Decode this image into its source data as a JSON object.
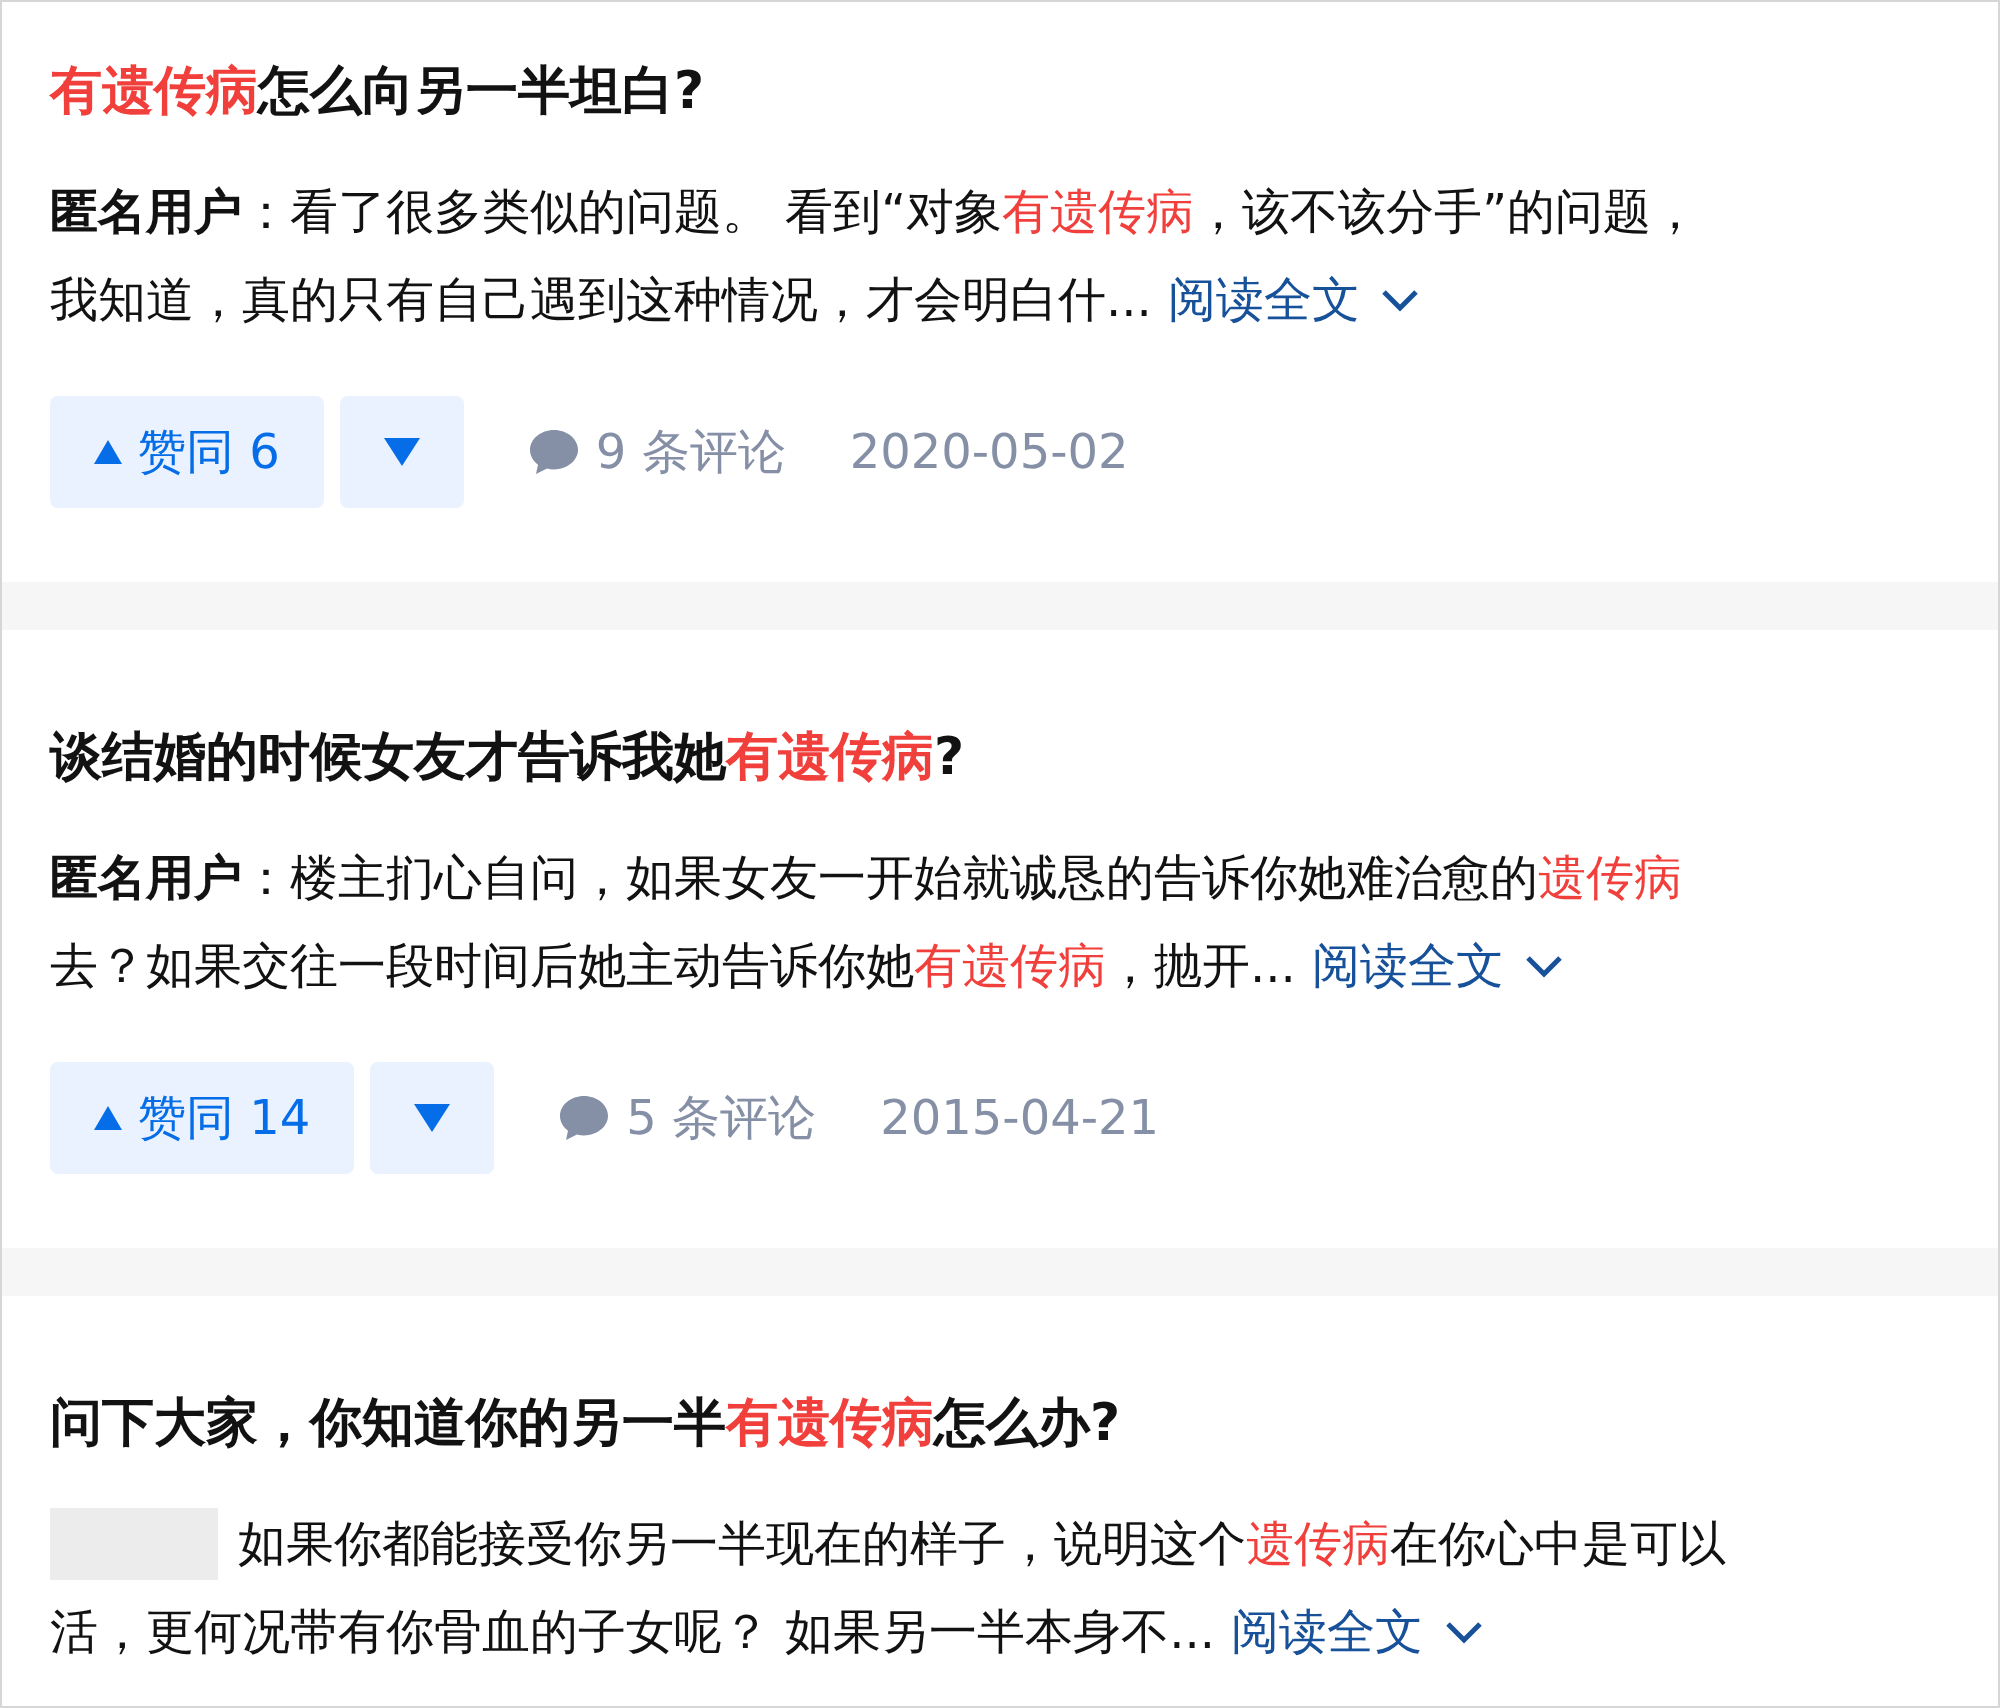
{
  "results": [
    {
      "title": [
        {
          "text": "有遗传病",
          "highlight": true
        },
        {
          "text": "怎么向另一半坦白?",
          "highlight": false
        }
      ],
      "author_hidden": false,
      "excerpt": [
        {
          "text": "匿名用户",
          "kind": "author"
        },
        {
          "text": "：看了很多类似的问题。 看到“对象",
          "kind": "plain"
        },
        {
          "text": "有遗传病",
          "kind": "highlight"
        },
        {
          "text": "，该不该分手”的问题，",
          "kind": "plain"
        },
        {
          "text": "我知道，真的只有自己遇到这种情况，才会明白什...",
          "kind": "plain"
        }
      ],
      "read_more": "阅读全文",
      "actions": {
        "upvote": "赞同 6",
        "comments": "9 条评论",
        "date": "2020-05-02"
      }
    },
    {
      "title": [
        {
          "text": "谈结婚的时候女友才告诉我她",
          "highlight": false
        },
        {
          "text": "有遗传病",
          "highlight": true
        },
        {
          "text": "?",
          "highlight": false
        }
      ],
      "author_hidden": false,
      "excerpt": [
        {
          "text": "匿名用户",
          "kind": "author"
        },
        {
          "text": "：楼主扪心自问，如果女友一开始就诚恳的告诉你她难治愈的",
          "kind": "plain"
        },
        {
          "text": "遗传病",
          "kind": "highlight"
        },
        {
          "text": "去？如果交往一段时间后她主动告诉你她",
          "kind": "plain"
        },
        {
          "text": "有遗传病",
          "kind": "highlight"
        },
        {
          "text": "，抛开...",
          "kind": "plain"
        }
      ],
      "read_more": "阅读全文",
      "actions": {
        "upvote": "赞同 14",
        "comments": "5 条评论",
        "date": "2015-04-21"
      }
    },
    {
      "title": [
        {
          "text": "问下大家，你知道你的另一半",
          "highlight": false
        },
        {
          "text": "有遗传病",
          "highlight": true
        },
        {
          "text": "怎么办?",
          "highlight": false
        }
      ],
      "author_hidden": true,
      "excerpt": [
        {
          "text": "如果你都能接受你另一半现在的样子，说明这个",
          "kind": "plain"
        },
        {
          "text": "遗传病",
          "kind": "highlight"
        },
        {
          "text": "在你心中是可以",
          "kind": "plain"
        },
        {
          "text": "活，更何况带有你骨血的子女呢？ 如果另一半本身不...",
          "kind": "plain"
        }
      ],
      "read_more": "阅读全文"
    }
  ]
}
